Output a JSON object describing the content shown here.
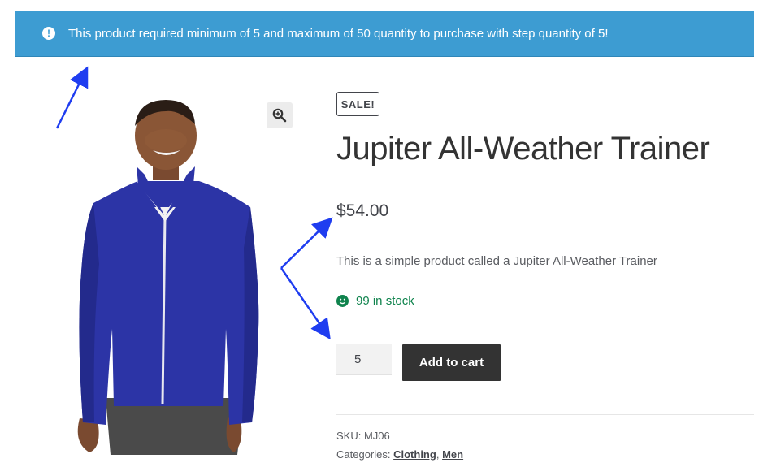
{
  "notice": {
    "icon": "info-icon",
    "icon_glyph": "!",
    "text": "This product required minimum of 5 and maximum of 50 quantity to purchase with step quantity of 5!"
  },
  "gallery": {
    "image": "product-photo-man-blue-jacket",
    "zoom_icon": "magnifier-zoom-icon"
  },
  "product": {
    "badge": "SALE!",
    "title": "Jupiter All-Weather Trainer",
    "price": "$54.00",
    "description": "This is a simple product called a Jupiter All-Weather Trainer",
    "stock": "99 in stock",
    "quantity": "5",
    "add_to_cart": "Add to cart"
  },
  "meta": {
    "sku_label": "SKU:",
    "sku_value": "MJ06",
    "categories_label": "Categories:",
    "category_1": "Clothing",
    "separator": ",",
    "category_2": "Men"
  },
  "colors": {
    "notice_bg": "#3d9cd2",
    "stock_green": "#0f834d",
    "button_bg": "#333333",
    "annotation_arrow": "#1f3df0"
  }
}
